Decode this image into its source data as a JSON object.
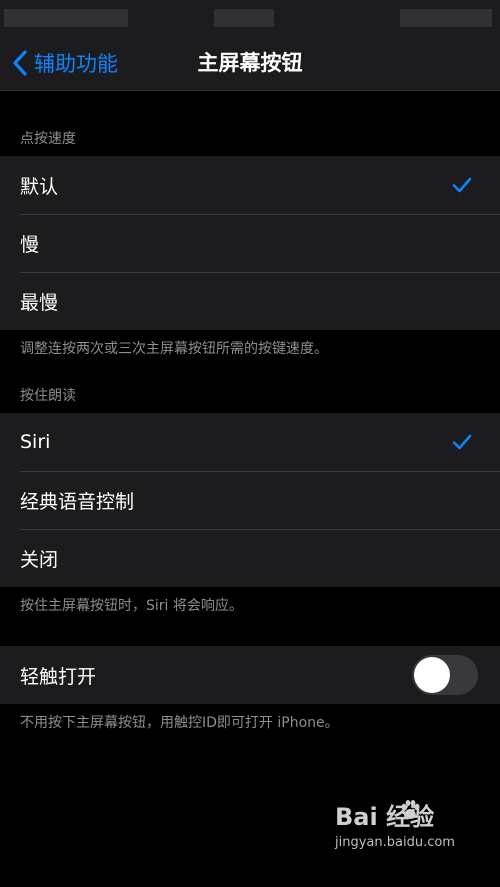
{
  "nav": {
    "back_label": "辅助功能",
    "title": "主屏幕按钮"
  },
  "click_speed": {
    "header": "点按速度",
    "options": [
      "默认",
      "慢",
      "最慢"
    ],
    "selected": "默认",
    "footer": "调整连按两次或三次主屏幕按钮所需的按键速度。"
  },
  "press_and_hold": {
    "header": "按住朗读",
    "options": [
      "Siri",
      "经典语音控制",
      "关闭"
    ],
    "selected": "Siri",
    "footer": "按住主屏幕按钮时，Siri 将会响应。"
  },
  "rest_finger": {
    "label": "轻触打开",
    "enabled": false,
    "footer": "不用按下主屏幕按钮，用触控ID即可打开 iPhone。"
  },
  "watermark": {
    "brand": "Bai  经验",
    "url": "jingyan.baidu.com"
  },
  "colors": {
    "accent": "#0a84ff",
    "group_bg": "#1c1c1e",
    "background": "#000000",
    "secondary_text": "#8e8e93"
  },
  "icons": {
    "back": "chevron-left-icon",
    "selected": "checkmark-icon",
    "watermark": "baidu-paw-icon"
  }
}
